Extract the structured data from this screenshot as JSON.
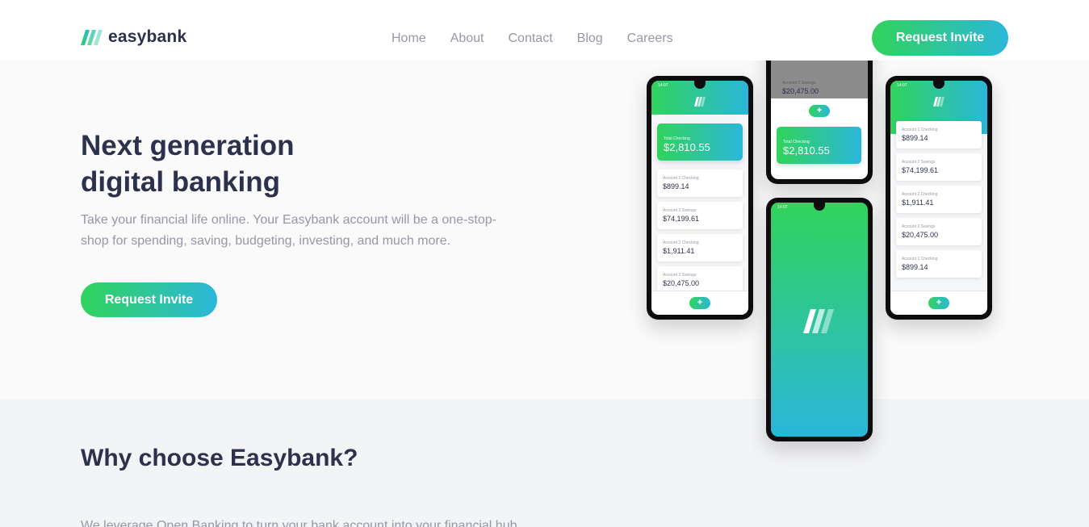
{
  "brand": {
    "name": "easybank",
    "colors": {
      "dark_blue": "#2d314d",
      "lime_green": "#31d35c",
      "bright_cyan": "#2bb7da",
      "grayish_blue": "#9698a6"
    }
  },
  "nav": {
    "items": [
      "Home",
      "About",
      "Contact",
      "Blog",
      "Careers"
    ]
  },
  "header": {
    "cta_label": "Request Invite"
  },
  "hero": {
    "title_line1": "Next generation",
    "title_line2": "digital banking",
    "text": "Take your financial life online. Your Easybank account will be a one-stop-shop for spending, saving, budgeting, investing, and much more.",
    "cta_label": "Request Invite"
  },
  "phones": {
    "left": {
      "status": "14:07",
      "total_label": "Total Checking",
      "total_amount": "$2,810.55",
      "accounts": [
        {
          "label": "Account 1 Checking",
          "amount": "$899.14"
        },
        {
          "label": "Account 2 Savings",
          "amount": "$74,199.61"
        },
        {
          "label": "Account 2 Checking",
          "amount": "$1,911.41"
        },
        {
          "label": "Account 2 Savings",
          "amount": "$20,475.00"
        }
      ],
      "fab": "+"
    },
    "top": {
      "account_label": "Account 2 Savings",
      "account_amount": "$20,475.00",
      "total_label": "Total Checking",
      "total_amount": "$2,810.55",
      "fab": "+"
    },
    "center": {
      "status": "14:07"
    },
    "right": {
      "status": "14:07",
      "accounts": [
        {
          "label": "Account 1 Checking",
          "amount": "$899.14"
        },
        {
          "label": "Account 2 Savings",
          "amount": "$74,199.61"
        },
        {
          "label": "Account 2 Checking",
          "amount": "$1,911.41"
        },
        {
          "label": "Account 2 Savings",
          "amount": "$20,475.00"
        },
        {
          "label": "Account 1 Checking",
          "amount": "$899.14"
        }
      ],
      "fab": "+"
    }
  },
  "why": {
    "title": "Why choose Easybank?",
    "text": "We leverage Open Banking to turn your bank account into your financial hub."
  }
}
